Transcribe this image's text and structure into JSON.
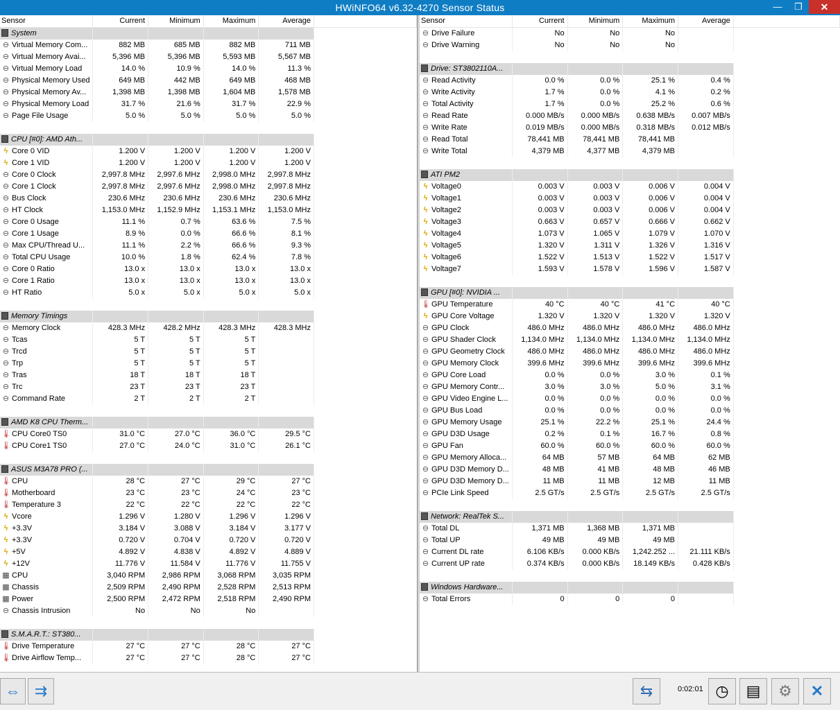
{
  "window": {
    "title": "HWiNFO64 v6.32-4270 Sensor Status",
    "min_glyph": "—",
    "max_glyph": "❐",
    "close_glyph": "✕"
  },
  "columns": [
    "Sensor",
    "Current",
    "Minimum",
    "Maximum",
    "Average"
  ],
  "left_rows": [
    {
      "g": "System"
    },
    {
      "i": "clock",
      "n": "Virtual Memory Com...",
      "v": [
        "882 MB",
        "685 MB",
        "882 MB",
        "711 MB"
      ]
    },
    {
      "i": "clock",
      "n": "Virtual Memory Avai...",
      "v": [
        "5,396 MB",
        "5,396 MB",
        "5,593 MB",
        "5,567 MB"
      ]
    },
    {
      "i": "clock",
      "n": "Virtual Memory Load",
      "v": [
        "14.0 %",
        "10.9 %",
        "14.0 %",
        "11.3 %"
      ]
    },
    {
      "i": "clock",
      "n": "Physical Memory Used",
      "v": [
        "649 MB",
        "442 MB",
        "649 MB",
        "468 MB"
      ]
    },
    {
      "i": "clock",
      "n": "Physical Memory Av...",
      "v": [
        "1,398 MB",
        "1,398 MB",
        "1,604 MB",
        "1,578 MB"
      ]
    },
    {
      "i": "clock",
      "n": "Physical Memory Load",
      "v": [
        "31.7 %",
        "21.6 %",
        "31.7 %",
        "22.9 %"
      ]
    },
    {
      "i": "clock",
      "n": "Page File Usage",
      "v": [
        "5.0 %",
        "5.0 %",
        "5.0 %",
        "5.0 %"
      ]
    },
    {
      "sep": true
    },
    {
      "g": "CPU [#0]: AMD Ath..."
    },
    {
      "i": "volt",
      "n": "Core 0 VID",
      "v": [
        "1.200 V",
        "1.200 V",
        "1.200 V",
        "1.200 V"
      ]
    },
    {
      "i": "volt",
      "n": "Core 1 VID",
      "v": [
        "1.200 V",
        "1.200 V",
        "1.200 V",
        "1.200 V"
      ]
    },
    {
      "i": "clock",
      "n": "Core 0 Clock",
      "v": [
        "2,997.8 MHz",
        "2,997.6 MHz",
        "2,998.0 MHz",
        "2,997.8 MHz"
      ]
    },
    {
      "i": "clock",
      "n": "Core 1 Clock",
      "v": [
        "2,997.8 MHz",
        "2,997.6 MHz",
        "2,998.0 MHz",
        "2,997.8 MHz"
      ]
    },
    {
      "i": "clock",
      "n": "Bus Clock",
      "v": [
        "230.6 MHz",
        "230.6 MHz",
        "230.6 MHz",
        "230.6 MHz"
      ]
    },
    {
      "i": "clock",
      "n": "HT Clock",
      "v": [
        "1,153.0 MHz",
        "1,152.9 MHz",
        "1,153.1 MHz",
        "1,153.0 MHz"
      ]
    },
    {
      "i": "clock",
      "n": "Core 0 Usage",
      "v": [
        "11.1 %",
        "0.7 %",
        "63.6 %",
        "7.5 %"
      ]
    },
    {
      "i": "clock",
      "n": "Core 1 Usage",
      "v": [
        "8.9 %",
        "0.0 %",
        "66.6 %",
        "8.1 %"
      ]
    },
    {
      "i": "clock",
      "n": "Max CPU/Thread U...",
      "v": [
        "11.1 %",
        "2.2 %",
        "66.6 %",
        "9.3 %"
      ]
    },
    {
      "i": "clock",
      "n": "Total CPU Usage",
      "v": [
        "10.0 %",
        "1.8 %",
        "62.4 %",
        "7.8 %"
      ]
    },
    {
      "i": "clock",
      "n": "Core 0 Ratio",
      "v": [
        "13.0 x",
        "13.0 x",
        "13.0 x",
        "13.0 x"
      ]
    },
    {
      "i": "clock",
      "n": "Core 1 Ratio",
      "v": [
        "13.0 x",
        "13.0 x",
        "13.0 x",
        "13.0 x"
      ]
    },
    {
      "i": "clock",
      "n": "HT Ratio",
      "v": [
        "5.0 x",
        "5.0 x",
        "5.0 x",
        "5.0 x"
      ]
    },
    {
      "sep": true
    },
    {
      "g": "Memory Timings"
    },
    {
      "i": "clock",
      "n": "Memory Clock",
      "v": [
        "428.3 MHz",
        "428.2 MHz",
        "428.3 MHz",
        "428.3 MHz"
      ]
    },
    {
      "i": "clock",
      "n": "Tcas",
      "v": [
        "5 T",
        "5 T",
        "5 T",
        ""
      ]
    },
    {
      "i": "clock",
      "n": "Trcd",
      "v": [
        "5 T",
        "5 T",
        "5 T",
        ""
      ]
    },
    {
      "i": "clock",
      "n": "Trp",
      "v": [
        "5 T",
        "5 T",
        "5 T",
        ""
      ]
    },
    {
      "i": "clock",
      "n": "Tras",
      "v": [
        "18 T",
        "18 T",
        "18 T",
        ""
      ]
    },
    {
      "i": "clock",
      "n": "Trc",
      "v": [
        "23 T",
        "23 T",
        "23 T",
        ""
      ]
    },
    {
      "i": "clock",
      "n": "Command Rate",
      "v": [
        "2 T",
        "2 T",
        "2 T",
        ""
      ]
    },
    {
      "sep": true
    },
    {
      "g": "AMD K8 CPU Therm..."
    },
    {
      "i": "temp",
      "n": "CPU Core0 TS0",
      "v": [
        "31.0 °C",
        "27.0 °C",
        "36.0 °C",
        "29.5 °C"
      ]
    },
    {
      "i": "temp",
      "n": "CPU Core1 TS0",
      "v": [
        "27.0 °C",
        "24.0 °C",
        "31.0 °C",
        "26.1 °C"
      ]
    },
    {
      "sep": true
    },
    {
      "g": "ASUS M3A78 PRO (..."
    },
    {
      "i": "temp",
      "n": "CPU",
      "v": [
        "28 °C",
        "27 °C",
        "29 °C",
        "27 °C"
      ]
    },
    {
      "i": "temp",
      "n": "Motherboard",
      "v": [
        "23 °C",
        "23 °C",
        "24 °C",
        "23 °C"
      ]
    },
    {
      "i": "temp",
      "n": "Temperature 3",
      "v": [
        "22 °C",
        "22 °C",
        "22 °C",
        "22 °C"
      ]
    },
    {
      "i": "volt",
      "n": "Vcore",
      "v": [
        "1.296 V",
        "1.280 V",
        "1.296 V",
        "1.296 V"
      ]
    },
    {
      "i": "volt",
      "n": "+3.3V",
      "v": [
        "3.184 V",
        "3.088 V",
        "3.184 V",
        "3.177 V"
      ]
    },
    {
      "i": "volt",
      "n": "+3.3V",
      "v": [
        "0.720 V",
        "0.704 V",
        "0.720 V",
        "0.720 V"
      ]
    },
    {
      "i": "volt",
      "n": "+5V",
      "v": [
        "4.892 V",
        "4.838 V",
        "4.892 V",
        "4.889 V"
      ]
    },
    {
      "i": "volt",
      "n": "+12V",
      "v": [
        "11.776 V",
        "11.584 V",
        "11.776 V",
        "11.755 V"
      ]
    },
    {
      "i": "fan",
      "n": "CPU",
      "v": [
        "3,040 RPM",
        "2,986 RPM",
        "3,068 RPM",
        "3,035 RPM"
      ]
    },
    {
      "i": "fan",
      "n": "Chassis",
      "v": [
        "2,509 RPM",
        "2,490 RPM",
        "2,528 RPM",
        "2,513 RPM"
      ]
    },
    {
      "i": "fan",
      "n": "Power",
      "v": [
        "2,500 RPM",
        "2,472 RPM",
        "2,518 RPM",
        "2,490 RPM"
      ]
    },
    {
      "i": "clock",
      "n": "Chassis Intrusion",
      "v": [
        "No",
        "No",
        "No",
        ""
      ]
    },
    {
      "sep": true
    },
    {
      "g": "S.M.A.R.T.: ST380..."
    },
    {
      "i": "temp",
      "n": "Drive Temperature",
      "v": [
        "27 °C",
        "27 °C",
        "28 °C",
        "27 °C"
      ]
    },
    {
      "i": "temp",
      "n": "Drive Airflow Temp...",
      "v": [
        "27 °C",
        "27 °C",
        "28 °C",
        "27 °C"
      ]
    }
  ],
  "right_rows": [
    {
      "i": "clock",
      "n": "Drive Failure",
      "v": [
        "No",
        "No",
        "No",
        ""
      ]
    },
    {
      "i": "clock",
      "n": "Drive Warning",
      "v": [
        "No",
        "No",
        "No",
        ""
      ]
    },
    {
      "sep": true
    },
    {
      "g": "Drive: ST3802110A..."
    },
    {
      "i": "clock",
      "n": "Read Activity",
      "v": [
        "0.0 %",
        "0.0 %",
        "25.1 %",
        "0.4 %"
      ]
    },
    {
      "i": "clock",
      "n": "Write Activity",
      "v": [
        "1.7 %",
        "0.0 %",
        "4.1 %",
        "0.2 %"
      ]
    },
    {
      "i": "clock",
      "n": "Total Activity",
      "v": [
        "1.7 %",
        "0.0 %",
        "25.2 %",
        "0.6 %"
      ]
    },
    {
      "i": "clock",
      "n": "Read Rate",
      "v": [
        "0.000 MB/s",
        "0.000 MB/s",
        "0.638 MB/s",
        "0.007 MB/s"
      ]
    },
    {
      "i": "clock",
      "n": "Write Rate",
      "v": [
        "0.019 MB/s",
        "0.000 MB/s",
        "0.318 MB/s",
        "0.012 MB/s"
      ]
    },
    {
      "i": "clock",
      "n": "Read Total",
      "v": [
        "78,441 MB",
        "78,441 MB",
        "78,441 MB",
        ""
      ]
    },
    {
      "i": "clock",
      "n": "Write Total",
      "v": [
        "4,379 MB",
        "4,377 MB",
        "4,379 MB",
        ""
      ]
    },
    {
      "sep": true
    },
    {
      "g": "ATI PM2"
    },
    {
      "i": "volt",
      "n": "Voltage0",
      "v": [
        "0.003 V",
        "0.003 V",
        "0.006 V",
        "0.004 V"
      ]
    },
    {
      "i": "volt",
      "n": "Voltage1",
      "v": [
        "0.003 V",
        "0.003 V",
        "0.006 V",
        "0.004 V"
      ]
    },
    {
      "i": "volt",
      "n": "Voltage2",
      "v": [
        "0.003 V",
        "0.003 V",
        "0.006 V",
        "0.004 V"
      ]
    },
    {
      "i": "volt",
      "n": "Voltage3",
      "v": [
        "0.663 V",
        "0.657 V",
        "0.666 V",
        "0.662 V"
      ]
    },
    {
      "i": "volt",
      "n": "Voltage4",
      "v": [
        "1.073 V",
        "1.065 V",
        "1.079 V",
        "1.070 V"
      ]
    },
    {
      "i": "volt",
      "n": "Voltage5",
      "v": [
        "1.320 V",
        "1.311 V",
        "1.326 V",
        "1.316 V"
      ]
    },
    {
      "i": "volt",
      "n": "Voltage6",
      "v": [
        "1.522 V",
        "1.513 V",
        "1.522 V",
        "1.517 V"
      ]
    },
    {
      "i": "volt",
      "n": "Voltage7",
      "v": [
        "1.593 V",
        "1.578 V",
        "1.596 V",
        "1.587 V"
      ]
    },
    {
      "sep": true
    },
    {
      "g": "GPU [#0]: NVIDIA ..."
    },
    {
      "i": "temp",
      "n": "GPU Temperature",
      "v": [
        "40 °C",
        "40 °C",
        "41 °C",
        "40 °C"
      ]
    },
    {
      "i": "volt",
      "n": "GPU Core Voltage",
      "v": [
        "1.320 V",
        "1.320 V",
        "1.320 V",
        "1.320 V"
      ]
    },
    {
      "i": "clock",
      "n": "GPU Clock",
      "v": [
        "486.0 MHz",
        "486.0 MHz",
        "486.0 MHz",
        "486.0 MHz"
      ]
    },
    {
      "i": "clock",
      "n": "GPU Shader Clock",
      "v": [
        "1,134.0 MHz",
        "1,134.0 MHz",
        "1,134.0 MHz",
        "1,134.0 MHz"
      ]
    },
    {
      "i": "clock",
      "n": "GPU Geometry Clock",
      "v": [
        "486.0 MHz",
        "486.0 MHz",
        "486.0 MHz",
        "486.0 MHz"
      ]
    },
    {
      "i": "clock",
      "n": "GPU Memory Clock",
      "v": [
        "399.6 MHz",
        "399.6 MHz",
        "399.6 MHz",
        "399.6 MHz"
      ]
    },
    {
      "i": "clock",
      "n": "GPU Core Load",
      "v": [
        "0.0 %",
        "0.0 %",
        "3.0 %",
        "0.1 %"
      ]
    },
    {
      "i": "clock",
      "n": "GPU Memory Contr...",
      "v": [
        "3.0 %",
        "3.0 %",
        "5.0 %",
        "3.1 %"
      ]
    },
    {
      "i": "clock",
      "n": "GPU Video Engine L...",
      "v": [
        "0.0 %",
        "0.0 %",
        "0.0 %",
        "0.0 %"
      ]
    },
    {
      "i": "clock",
      "n": "GPU Bus Load",
      "v": [
        "0.0 %",
        "0.0 %",
        "0.0 %",
        "0.0 %"
      ]
    },
    {
      "i": "clock",
      "n": "GPU Memory Usage",
      "v": [
        "25.1 %",
        "22.2 %",
        "25.1 %",
        "24.4 %"
      ]
    },
    {
      "i": "clock",
      "n": "GPU D3D Usage",
      "v": [
        "0.2 %",
        "0.1 %",
        "16.7 %",
        "0.8 %"
      ]
    },
    {
      "i": "clock",
      "n": "GPU Fan",
      "v": [
        "60.0 %",
        "60.0 %",
        "60.0 %",
        "60.0 %"
      ]
    },
    {
      "i": "clock",
      "n": "GPU Memory Alloca...",
      "v": [
        "64 MB",
        "57 MB",
        "64 MB",
        "62 MB"
      ]
    },
    {
      "i": "clock",
      "n": "GPU D3D Memory D...",
      "v": [
        "48 MB",
        "41 MB",
        "48 MB",
        "46 MB"
      ]
    },
    {
      "i": "clock",
      "n": "GPU D3D Memory D...",
      "v": [
        "11 MB",
        "11 MB",
        "12 MB",
        "11 MB"
      ]
    },
    {
      "i": "clock",
      "n": "PCIe Link Speed",
      "v": [
        "2.5 GT/s",
        "2.5 GT/s",
        "2.5 GT/s",
        "2.5 GT/s"
      ]
    },
    {
      "sep": true
    },
    {
      "g": "Network: RealTek S..."
    },
    {
      "i": "clock",
      "n": "Total DL",
      "v": [
        "1,371 MB",
        "1,368 MB",
        "1,371 MB",
        ""
      ]
    },
    {
      "i": "clock",
      "n": "Total UP",
      "v": [
        "49 MB",
        "49 MB",
        "49 MB",
        ""
      ]
    },
    {
      "i": "clock",
      "n": "Current DL rate",
      "v": [
        "6.106 KB/s",
        "0.000 KB/s",
        "1,242.252 ...",
        "21.111 KB/s"
      ]
    },
    {
      "i": "clock",
      "n": "Current UP rate",
      "v": [
        "0.374 KB/s",
        "0.000 KB/s",
        "18.149 KB/s",
        "0.428 KB/s"
      ]
    },
    {
      "sep": true
    },
    {
      "g": "Windows Hardware..."
    },
    {
      "i": "clock",
      "n": "Total Errors",
      "v": [
        "0",
        "0",
        "0",
        ""
      ]
    }
  ],
  "icons": {
    "clock": {
      "glyph": "⊖",
      "name": "clock-icon"
    },
    "volt": {
      "glyph": "ϟ",
      "name": "voltage-icon"
    },
    "temp": {
      "glyph": "🌡",
      "name": "thermometer-icon"
    },
    "fan": {
      "glyph": "▦",
      "name": "fan-icon"
    }
  },
  "statusbar": {
    "prev_glyph": "⇔",
    "next_glyph": "⇉",
    "net_glyph": "⇆",
    "timer": "0:02:01",
    "clock_glyph": "◷",
    "log_glyph": "▤",
    "settings_glyph": "⚙",
    "exit_glyph": "✕"
  }
}
